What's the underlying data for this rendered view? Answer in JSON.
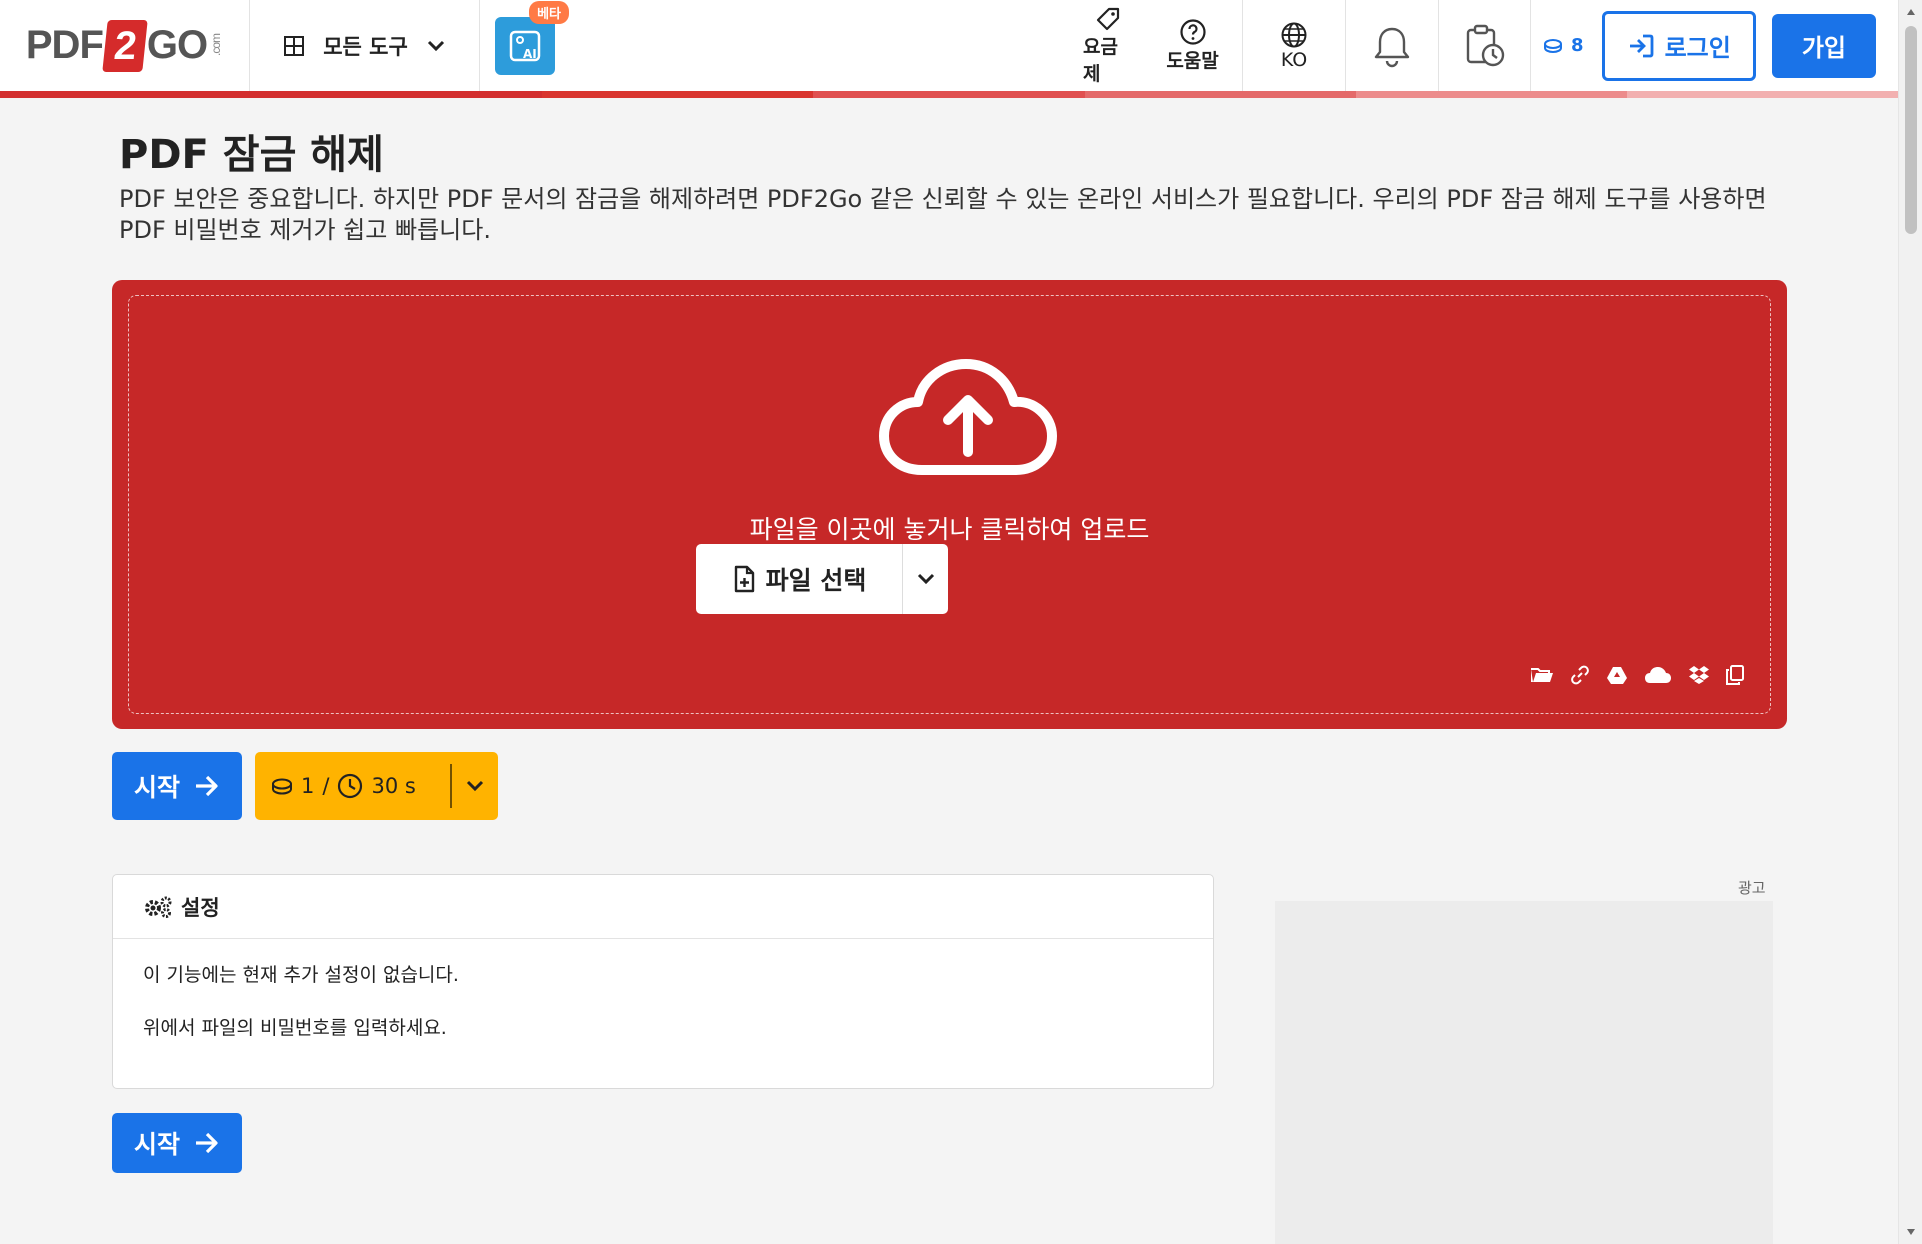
{
  "header": {
    "logo_left": "PDF",
    "logo_two": "2",
    "logo_right": "GO",
    "logo_com": ".com",
    "tools_label": "모든 도구",
    "ai_badge": "베타",
    "ai_icon_text": "AI",
    "pricing_label": "요금제",
    "help_label": "도움말",
    "language_label": "KO",
    "credits_count": "8",
    "login_label": "로그인",
    "signup_label": "가입"
  },
  "strip_colors": [
    "#d32f2f",
    "#d32f2f",
    "#d9352f",
    "#e05050",
    "#e46a6a",
    "#ec8c8c",
    "#f2b0b0"
  ],
  "colors": {
    "accent_blue": "#1a73e8",
    "dropzone_red": "#c62828",
    "cost_amber": "#ffb300"
  },
  "main": {
    "title": "PDF 잠금 해제",
    "description": "PDF 보안은 중요합니다. 하지만 PDF 문서의 잠금을 해제하려면 PDF2Go 같은 신뢰할 수 있는 온라인 서비스가 필요합니다. 우리의 PDF 잠금 해제 도구를 사용하면 PDF 비밀번호 제거가 쉽고 빠릅니다.",
    "dropzone": {
      "prompt": "파일을 이곳에 놓거나 클릭하여 업로드",
      "choose_file_label": "파일 선택",
      "source_icons": [
        "folder-icon",
        "link-icon",
        "google-drive-icon",
        "onedrive-icon",
        "dropbox-icon",
        "clipboard-icon"
      ]
    },
    "start_label": "시작",
    "cost": {
      "credits": "1",
      "separator": "/",
      "time": "30 s"
    },
    "settings": {
      "title": "설정",
      "line1": "이 기능에는 현재 추가 설정이 없습니다.",
      "line2": "위에서 파일의 비밀번호를 입력하세요."
    },
    "ad_label": "광고"
  }
}
